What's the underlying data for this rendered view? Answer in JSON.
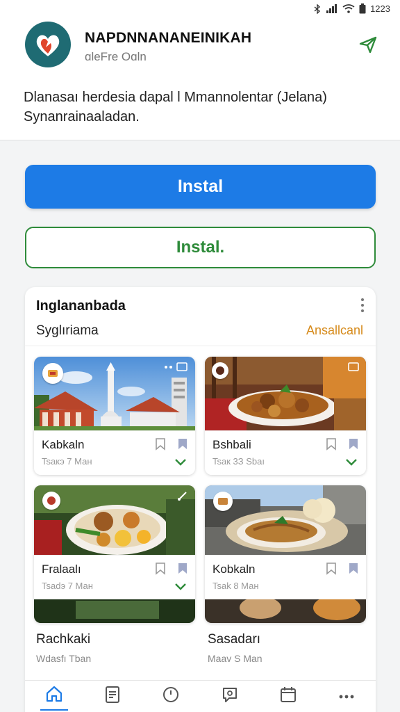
{
  "status_bar": {
    "time": "1223"
  },
  "app": {
    "title": "NAPDNNANANEINIKAH",
    "subtitle": "ɑleFre Oɑln",
    "description": "Dlanasaı herdesia dapal l Mmannolentar (Jelana) Synanrainaaladan."
  },
  "buttons": {
    "primary_label": "Instal",
    "secondary_label": "Instal."
  },
  "panel": {
    "title": "Inglananbada",
    "subtitle": "Syglıriama",
    "action_label": "Ansallcanl"
  },
  "cards": [
    {
      "name": "Kabkaln",
      "meta": "Tsaкэ 7 Ман"
    },
    {
      "name": "Bshbali",
      "meta": "Tsaк 3З Sbaı"
    },
    {
      "name": "Fralaalı",
      "meta": "Tsadэ 7 Ман"
    },
    {
      "name": "Kobkaln",
      "meta": "Tsak 8 Ман"
    }
  ],
  "plain_items": [
    {
      "name": "Rachkaki",
      "meta": "Wdasfı Tban"
    },
    {
      "name": "Sasadarı",
      "meta": "Maav S Man"
    }
  ],
  "colors": {
    "primary": "#1d7be6",
    "secondary": "#2e8b3a",
    "accent": "#d68a1a",
    "logo_bg": "#1f6b73"
  },
  "icons": {
    "share": "send-icon",
    "nav": [
      "home-icon",
      "document-icon",
      "clock-icon",
      "chat-icon",
      "calendar-icon",
      "more-icon"
    ]
  }
}
